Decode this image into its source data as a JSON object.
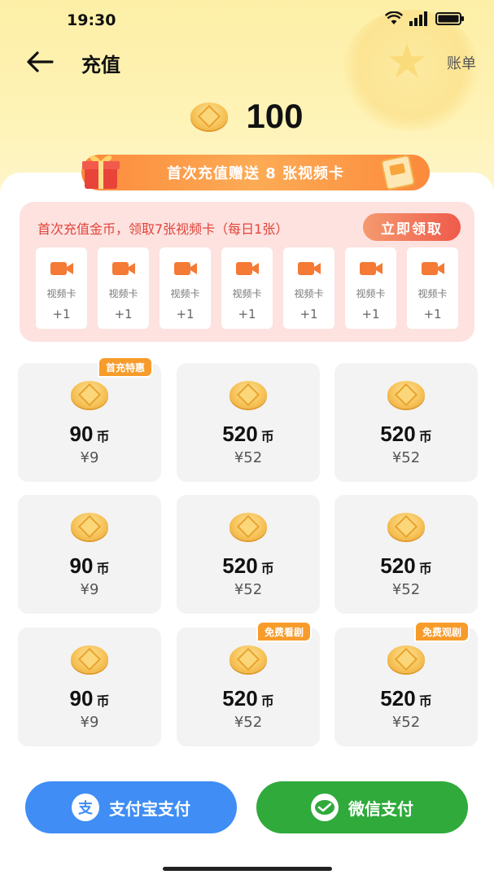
{
  "status": {
    "time": "19:30"
  },
  "nav": {
    "title": "充值",
    "bill_label": "账单"
  },
  "balance": {
    "value": "100"
  },
  "promo": {
    "text": "首次充值赠送 8 张视频卡"
  },
  "first_charge": {
    "text": "首次充值金币，领取7张视频卡（每日1张）",
    "claim_label": "立即领取",
    "cards": [
      {
        "label": "视频卡",
        "count": "+1"
      },
      {
        "label": "视频卡",
        "count": "+1"
      },
      {
        "label": "视频卡",
        "count": "+1"
      },
      {
        "label": "视频卡",
        "count": "+1"
      },
      {
        "label": "视频卡",
        "count": "+1"
      },
      {
        "label": "视频卡",
        "count": "+1"
      },
      {
        "label": "视频卡",
        "count": "+1"
      }
    ]
  },
  "coin_unit": "币",
  "packages": [
    {
      "coins": "90",
      "price": "¥9",
      "tag": "首充特惠"
    },
    {
      "coins": "520",
      "price": "¥52",
      "tag": ""
    },
    {
      "coins": "520",
      "price": "¥52",
      "tag": ""
    },
    {
      "coins": "90",
      "price": "¥9",
      "tag": ""
    },
    {
      "coins": "520",
      "price": "¥52",
      "tag": ""
    },
    {
      "coins": "520",
      "price": "¥52",
      "tag": ""
    },
    {
      "coins": "90",
      "price": "¥9",
      "tag": ""
    },
    {
      "coins": "520",
      "price": "¥52",
      "tag": "免费看剧"
    },
    {
      "coins": "520",
      "price": "¥52",
      "tag": "免费观剧"
    }
  ],
  "payment": {
    "alipay_label": "支付宝支付",
    "wechat_label": "微信支付",
    "alipay_icon_char": "支"
  },
  "colors": {
    "accent_orange": "#fb8a3c",
    "alipay_blue": "#3f8df5",
    "wechat_green": "#2faa3b",
    "claim_red": "#ef5a4b"
  }
}
